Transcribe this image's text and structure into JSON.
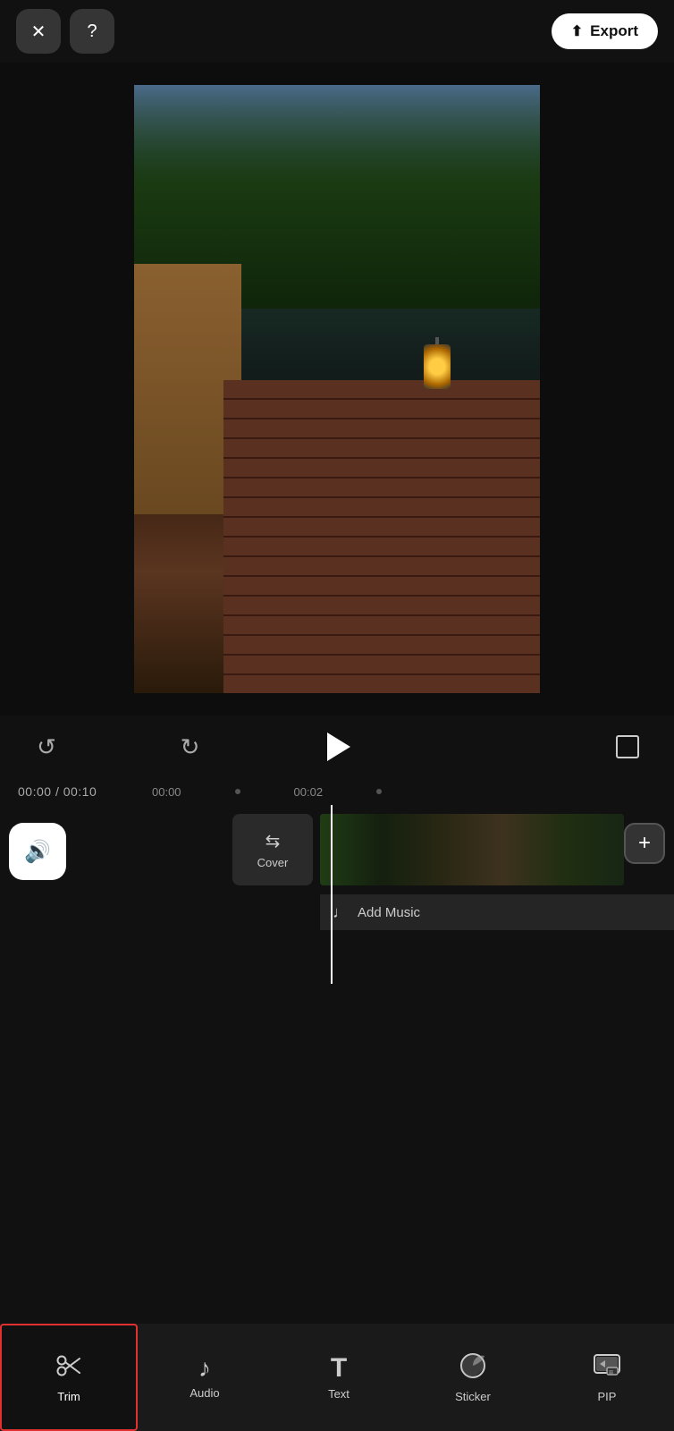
{
  "header": {
    "close_label": "✕",
    "help_label": "?",
    "export_label": "Export"
  },
  "controls": {
    "undo_label": "↺",
    "redo_label": "↻",
    "play_label": "▶",
    "time_current": "00:00",
    "time_separator": " / ",
    "time_total": "00:10"
  },
  "timeline": {
    "marker_0": "00:00",
    "marker_2": "00:02",
    "cover_label": "Cover",
    "add_music_label": "Add Music"
  },
  "toolbar": {
    "items": [
      {
        "id": "trim",
        "label": "Trim",
        "active": true
      },
      {
        "id": "audio",
        "label": "Audio",
        "active": false
      },
      {
        "id": "text",
        "label": "Text",
        "active": false
      },
      {
        "id": "sticker",
        "label": "Sticker",
        "active": false
      },
      {
        "id": "pip",
        "label": "PIP",
        "active": false
      }
    ]
  }
}
